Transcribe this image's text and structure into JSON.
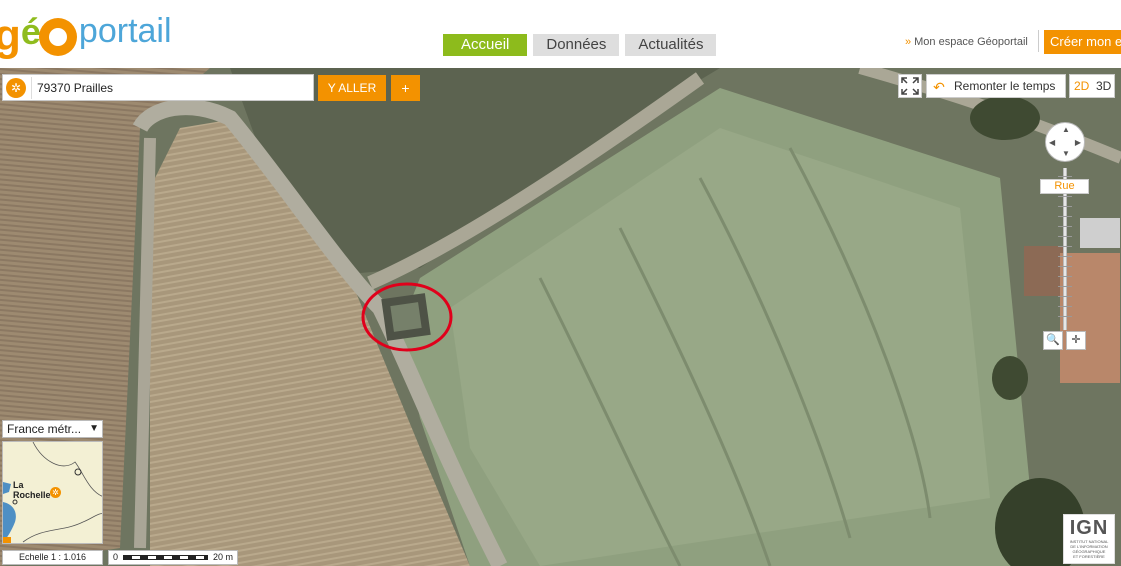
{
  "header": {
    "logo": {
      "g": "g",
      "e": "é",
      "portail": "portail"
    },
    "nav": [
      {
        "label": "Accueil",
        "active": true
      },
      {
        "label": "Données",
        "active": false
      },
      {
        "label": "Actualités",
        "active": false
      }
    ],
    "my_space": "Mon espace Géoportail",
    "my_space_arrow": "»",
    "create_account": "Créer mon e"
  },
  "search": {
    "value": "79370 Prailles",
    "go_label": "Y ALLER",
    "plus_label": "+"
  },
  "map_controls": {
    "time_label": "Remonter le temps",
    "dim_2d": "2D",
    "dim_3d": "3D",
    "zoom_level_label": "Rue",
    "zoom_tool_1": "🔍",
    "zoom_tool_2": "✛"
  },
  "overview": {
    "territory": "France métr...",
    "caret": "▼",
    "town_line1": "La",
    "town_line2": "Rochelle"
  },
  "scale": {
    "ratio_text": "Echelle 1 :   1.016",
    "zero": "0",
    "distance": "20 m"
  },
  "ign": {
    "title": "IGN",
    "line1": "INSTITUT NATIONAL",
    "line2": "DE L'INFORMATION",
    "line3": "GÉOGRAPHIQUE",
    "line4": "ET FORESTIÈRE"
  },
  "colors": {
    "brand_orange": "#f39200",
    "brand_green": "#8dbb1c",
    "brand_blue": "#4da6d9",
    "highlight_circle": "#e0001b"
  }
}
